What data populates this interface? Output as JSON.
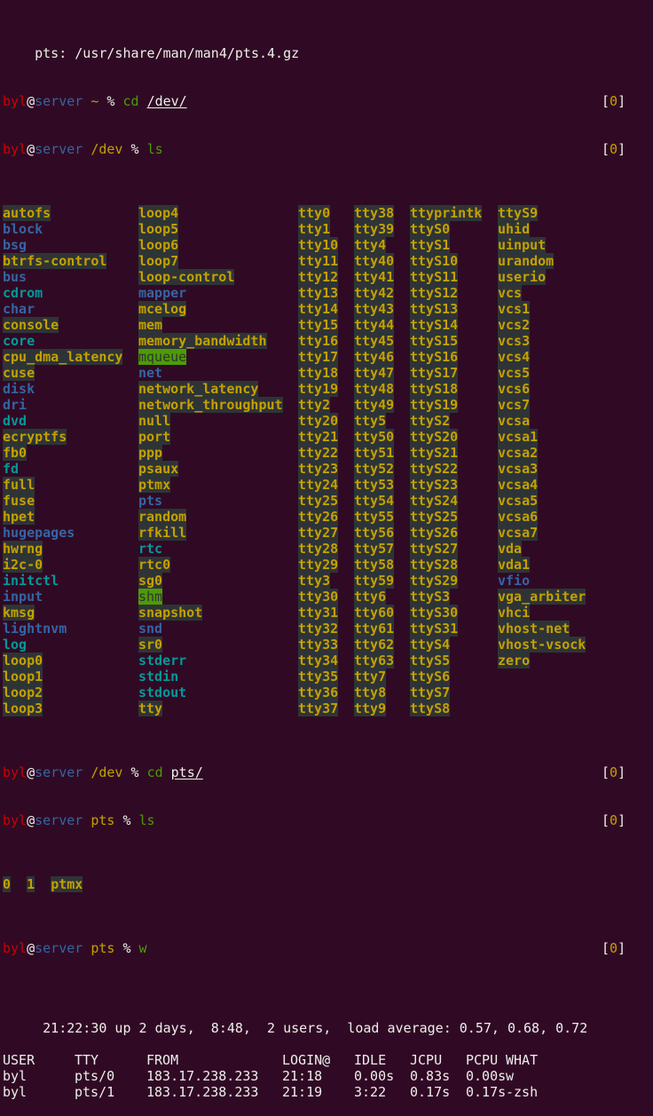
{
  "window": {
    "type": "terminal",
    "background": "#300a24"
  },
  "colors": {
    "user": "#cc0000",
    "host": "#3465a4",
    "path": "#c4a000",
    "command": "#4e9a06",
    "directory": "#3465a4",
    "symlink": "#06989a",
    "device_fg": "#c4a000",
    "device_bg": "#2e3436",
    "sticky_bg": "#4e9a06"
  },
  "lines": {
    "partial_top": "pts: /usr/share/man/man4/pts.4.gz",
    "prompt1": {
      "user": "byl",
      "at": "@",
      "host": "server",
      "path": "~",
      "symbol": "%",
      "command": "cd",
      "arg": "/dev/",
      "status": "0"
    },
    "prompt2": {
      "user": "byl",
      "at": "@",
      "host": "server",
      "path": "/dev",
      "symbol": "%",
      "command": "ls",
      "arg": "",
      "status": "0"
    },
    "prompt3": {
      "user": "byl",
      "at": "@",
      "host": "server",
      "path": "/dev",
      "symbol": "%",
      "command": "cd",
      "arg": "pts/",
      "status": "0"
    },
    "prompt4": {
      "user": "byl",
      "at": "@",
      "host": "server",
      "path": "pts",
      "symbol": "%",
      "command": "ls",
      "arg": "",
      "status": "0"
    },
    "prompt5": {
      "user": "byl",
      "at": "@",
      "host": "server",
      "path": "pts",
      "symbol": "%",
      "command": "w",
      "arg": "",
      "status": "0"
    }
  },
  "ls_dev": {
    "columns": [
      [
        {
          "name": "autofs",
          "type": "dev"
        },
        {
          "name": "block",
          "type": "dir"
        },
        {
          "name": "bsg",
          "type": "dir"
        },
        {
          "name": "btrfs-control",
          "type": "dev"
        },
        {
          "name": "bus",
          "type": "dir"
        },
        {
          "name": "cdrom",
          "type": "link"
        },
        {
          "name": "char",
          "type": "dir"
        },
        {
          "name": "console",
          "type": "dev"
        },
        {
          "name": "core",
          "type": "link"
        },
        {
          "name": "cpu_dma_latency",
          "type": "dev"
        },
        {
          "name": "cuse",
          "type": "dev"
        },
        {
          "name": "disk",
          "type": "dir"
        },
        {
          "name": "dri",
          "type": "dir"
        },
        {
          "name": "dvd",
          "type": "link"
        },
        {
          "name": "ecryptfs",
          "type": "dev"
        },
        {
          "name": "fb0",
          "type": "dev"
        },
        {
          "name": "fd",
          "type": "link"
        },
        {
          "name": "full",
          "type": "dev"
        },
        {
          "name": "fuse",
          "type": "dev"
        },
        {
          "name": "hpet",
          "type": "dev"
        },
        {
          "name": "hugepages",
          "type": "dir"
        },
        {
          "name": "hwrng",
          "type": "dev"
        },
        {
          "name": "i2c-0",
          "type": "dev"
        },
        {
          "name": "initctl",
          "type": "link"
        },
        {
          "name": "input",
          "type": "dir"
        },
        {
          "name": "kmsg",
          "type": "dev"
        },
        {
          "name": "lightnvm",
          "type": "dir"
        },
        {
          "name": "log",
          "type": "link"
        },
        {
          "name": "loop0",
          "type": "dev"
        },
        {
          "name": "loop1",
          "type": "dev"
        },
        {
          "name": "loop2",
          "type": "dev"
        },
        {
          "name": "loop3",
          "type": "dev"
        }
      ],
      [
        {
          "name": "loop4",
          "type": "dev"
        },
        {
          "name": "loop5",
          "type": "dev"
        },
        {
          "name": "loop6",
          "type": "dev"
        },
        {
          "name": "loop7",
          "type": "dev"
        },
        {
          "name": "loop-control",
          "type": "dev"
        },
        {
          "name": "mapper",
          "type": "dir"
        },
        {
          "name": "mcelog",
          "type": "dev"
        },
        {
          "name": "mem",
          "type": "dev"
        },
        {
          "name": "memory_bandwidth",
          "type": "dev"
        },
        {
          "name": "mqueue",
          "type": "sticky"
        },
        {
          "name": "net",
          "type": "dir"
        },
        {
          "name": "network_latency",
          "type": "dev"
        },
        {
          "name": "network_throughput",
          "type": "dev"
        },
        {
          "name": "null",
          "type": "dev"
        },
        {
          "name": "port",
          "type": "dev"
        },
        {
          "name": "ppp",
          "type": "dev"
        },
        {
          "name": "psaux",
          "type": "dev"
        },
        {
          "name": "ptmx",
          "type": "dev"
        },
        {
          "name": "pts",
          "type": "dir"
        },
        {
          "name": "random",
          "type": "dev"
        },
        {
          "name": "rfkill",
          "type": "dev"
        },
        {
          "name": "rtc",
          "type": "link"
        },
        {
          "name": "rtc0",
          "type": "dev"
        },
        {
          "name": "sg0",
          "type": "dev"
        },
        {
          "name": "shm",
          "type": "sticky"
        },
        {
          "name": "snapshot",
          "type": "dev"
        },
        {
          "name": "snd",
          "type": "dir"
        },
        {
          "name": "sr0",
          "type": "dev"
        },
        {
          "name": "stderr",
          "type": "link"
        },
        {
          "name": "stdin",
          "type": "link"
        },
        {
          "name": "stdout",
          "type": "link"
        },
        {
          "name": "tty",
          "type": "dev"
        }
      ],
      [
        {
          "name": "tty0",
          "type": "dev"
        },
        {
          "name": "tty1",
          "type": "dev"
        },
        {
          "name": "tty10",
          "type": "dev"
        },
        {
          "name": "tty11",
          "type": "dev"
        },
        {
          "name": "tty12",
          "type": "dev"
        },
        {
          "name": "tty13",
          "type": "dev"
        },
        {
          "name": "tty14",
          "type": "dev"
        },
        {
          "name": "tty15",
          "type": "dev"
        },
        {
          "name": "tty16",
          "type": "dev"
        },
        {
          "name": "tty17",
          "type": "dev"
        },
        {
          "name": "tty18",
          "type": "dev"
        },
        {
          "name": "tty19",
          "type": "dev"
        },
        {
          "name": "tty2",
          "type": "dev"
        },
        {
          "name": "tty20",
          "type": "dev"
        },
        {
          "name": "tty21",
          "type": "dev"
        },
        {
          "name": "tty22",
          "type": "dev"
        },
        {
          "name": "tty23",
          "type": "dev"
        },
        {
          "name": "tty24",
          "type": "dev"
        },
        {
          "name": "tty25",
          "type": "dev"
        },
        {
          "name": "tty26",
          "type": "dev"
        },
        {
          "name": "tty27",
          "type": "dev"
        },
        {
          "name": "tty28",
          "type": "dev"
        },
        {
          "name": "tty29",
          "type": "dev"
        },
        {
          "name": "tty3",
          "type": "dev"
        },
        {
          "name": "tty30",
          "type": "dev"
        },
        {
          "name": "tty31",
          "type": "dev"
        },
        {
          "name": "tty32",
          "type": "dev"
        },
        {
          "name": "tty33",
          "type": "dev"
        },
        {
          "name": "tty34",
          "type": "dev"
        },
        {
          "name": "tty35",
          "type": "dev"
        },
        {
          "name": "tty36",
          "type": "dev"
        },
        {
          "name": "tty37",
          "type": "dev"
        }
      ],
      [
        {
          "name": "tty38",
          "type": "dev"
        },
        {
          "name": "tty39",
          "type": "dev"
        },
        {
          "name": "tty4",
          "type": "dev"
        },
        {
          "name": "tty40",
          "type": "dev"
        },
        {
          "name": "tty41",
          "type": "dev"
        },
        {
          "name": "tty42",
          "type": "dev"
        },
        {
          "name": "tty43",
          "type": "dev"
        },
        {
          "name": "tty44",
          "type": "dev"
        },
        {
          "name": "tty45",
          "type": "dev"
        },
        {
          "name": "tty46",
          "type": "dev"
        },
        {
          "name": "tty47",
          "type": "dev"
        },
        {
          "name": "tty48",
          "type": "dev"
        },
        {
          "name": "tty49",
          "type": "dev"
        },
        {
          "name": "tty5",
          "type": "dev"
        },
        {
          "name": "tty50",
          "type": "dev"
        },
        {
          "name": "tty51",
          "type": "dev"
        },
        {
          "name": "tty52",
          "type": "dev"
        },
        {
          "name": "tty53",
          "type": "dev"
        },
        {
          "name": "tty54",
          "type": "dev"
        },
        {
          "name": "tty55",
          "type": "dev"
        },
        {
          "name": "tty56",
          "type": "dev"
        },
        {
          "name": "tty57",
          "type": "dev"
        },
        {
          "name": "tty58",
          "type": "dev"
        },
        {
          "name": "tty59",
          "type": "dev"
        },
        {
          "name": "tty6",
          "type": "dev"
        },
        {
          "name": "tty60",
          "type": "dev"
        },
        {
          "name": "tty61",
          "type": "dev"
        },
        {
          "name": "tty62",
          "type": "dev"
        },
        {
          "name": "tty63",
          "type": "dev"
        },
        {
          "name": "tty7",
          "type": "dev"
        },
        {
          "name": "tty8",
          "type": "dev"
        },
        {
          "name": "tty9",
          "type": "dev"
        }
      ],
      [
        {
          "name": "ttyprintk",
          "type": "dev"
        },
        {
          "name": "ttyS0",
          "type": "dev"
        },
        {
          "name": "ttyS1",
          "type": "dev"
        },
        {
          "name": "ttyS10",
          "type": "dev"
        },
        {
          "name": "ttyS11",
          "type": "dev"
        },
        {
          "name": "ttyS12",
          "type": "dev"
        },
        {
          "name": "ttyS13",
          "type": "dev"
        },
        {
          "name": "ttyS14",
          "type": "dev"
        },
        {
          "name": "ttyS15",
          "type": "dev"
        },
        {
          "name": "ttyS16",
          "type": "dev"
        },
        {
          "name": "ttyS17",
          "type": "dev"
        },
        {
          "name": "ttyS18",
          "type": "dev"
        },
        {
          "name": "ttyS19",
          "type": "dev"
        },
        {
          "name": "ttyS2",
          "type": "dev"
        },
        {
          "name": "ttyS20",
          "type": "dev"
        },
        {
          "name": "ttyS21",
          "type": "dev"
        },
        {
          "name": "ttyS22",
          "type": "dev"
        },
        {
          "name": "ttyS23",
          "type": "dev"
        },
        {
          "name": "ttyS24",
          "type": "dev"
        },
        {
          "name": "ttyS25",
          "type": "dev"
        },
        {
          "name": "ttyS26",
          "type": "dev"
        },
        {
          "name": "ttyS27",
          "type": "dev"
        },
        {
          "name": "ttyS28",
          "type": "dev"
        },
        {
          "name": "ttyS29",
          "type": "dev"
        },
        {
          "name": "ttyS3",
          "type": "dev"
        },
        {
          "name": "ttyS30",
          "type": "dev"
        },
        {
          "name": "ttyS31",
          "type": "dev"
        },
        {
          "name": "ttyS4",
          "type": "dev"
        },
        {
          "name": "ttyS5",
          "type": "dev"
        },
        {
          "name": "ttyS6",
          "type": "dev"
        },
        {
          "name": "ttyS7",
          "type": "dev"
        },
        {
          "name": "ttyS8",
          "type": "dev"
        }
      ],
      [
        {
          "name": "ttyS9",
          "type": "dev"
        },
        {
          "name": "uhid",
          "type": "dev"
        },
        {
          "name": "uinput",
          "type": "dev"
        },
        {
          "name": "urandom",
          "type": "dev"
        },
        {
          "name": "userio",
          "type": "dev"
        },
        {
          "name": "vcs",
          "type": "dev"
        },
        {
          "name": "vcs1",
          "type": "dev"
        },
        {
          "name": "vcs2",
          "type": "dev"
        },
        {
          "name": "vcs3",
          "type": "dev"
        },
        {
          "name": "vcs4",
          "type": "dev"
        },
        {
          "name": "vcs5",
          "type": "dev"
        },
        {
          "name": "vcs6",
          "type": "dev"
        },
        {
          "name": "vcs7",
          "type": "dev"
        },
        {
          "name": "vcsa",
          "type": "dev"
        },
        {
          "name": "vcsa1",
          "type": "dev"
        },
        {
          "name": "vcsa2",
          "type": "dev"
        },
        {
          "name": "vcsa3",
          "type": "dev"
        },
        {
          "name": "vcsa4",
          "type": "dev"
        },
        {
          "name": "vcsa5",
          "type": "dev"
        },
        {
          "name": "vcsa6",
          "type": "dev"
        },
        {
          "name": "vcsa7",
          "type": "dev"
        },
        {
          "name": "vda",
          "type": "dev"
        },
        {
          "name": "vda1",
          "type": "dev"
        },
        {
          "name": "vfio",
          "type": "dir"
        },
        {
          "name": "vga_arbiter",
          "type": "dev"
        },
        {
          "name": "vhci",
          "type": "dev"
        },
        {
          "name": "vhost-net",
          "type": "dev"
        },
        {
          "name": "vhost-vsock",
          "type": "dev"
        },
        {
          "name": "zero",
          "type": "dev"
        }
      ]
    ]
  },
  "ls_pts": [
    {
      "name": "0",
      "type": "dev"
    },
    {
      "name": "1",
      "type": "dev"
    },
    {
      "name": "ptmx",
      "type": "dev"
    }
  ],
  "w_output": {
    "uptime_line": " 21:22:30 up 2 days,  8:48,  2 users,  load average: 0.57, 0.68, 0.72",
    "headers": [
      "USER",
      "TTY",
      "FROM",
      "LOGIN@",
      "IDLE",
      "JCPU",
      "PCPU",
      "WHAT"
    ],
    "rows": [
      [
        "byl",
        "pts/0",
        "183.17.238.233",
        "21:18",
        "0.00s",
        "0.83s",
        "0.00s",
        "w"
      ],
      [
        "byl",
        "pts/1",
        "183.17.238.233",
        "21:19",
        "3:22",
        "0.17s",
        "0.17s",
        "-zsh"
      ]
    ]
  }
}
